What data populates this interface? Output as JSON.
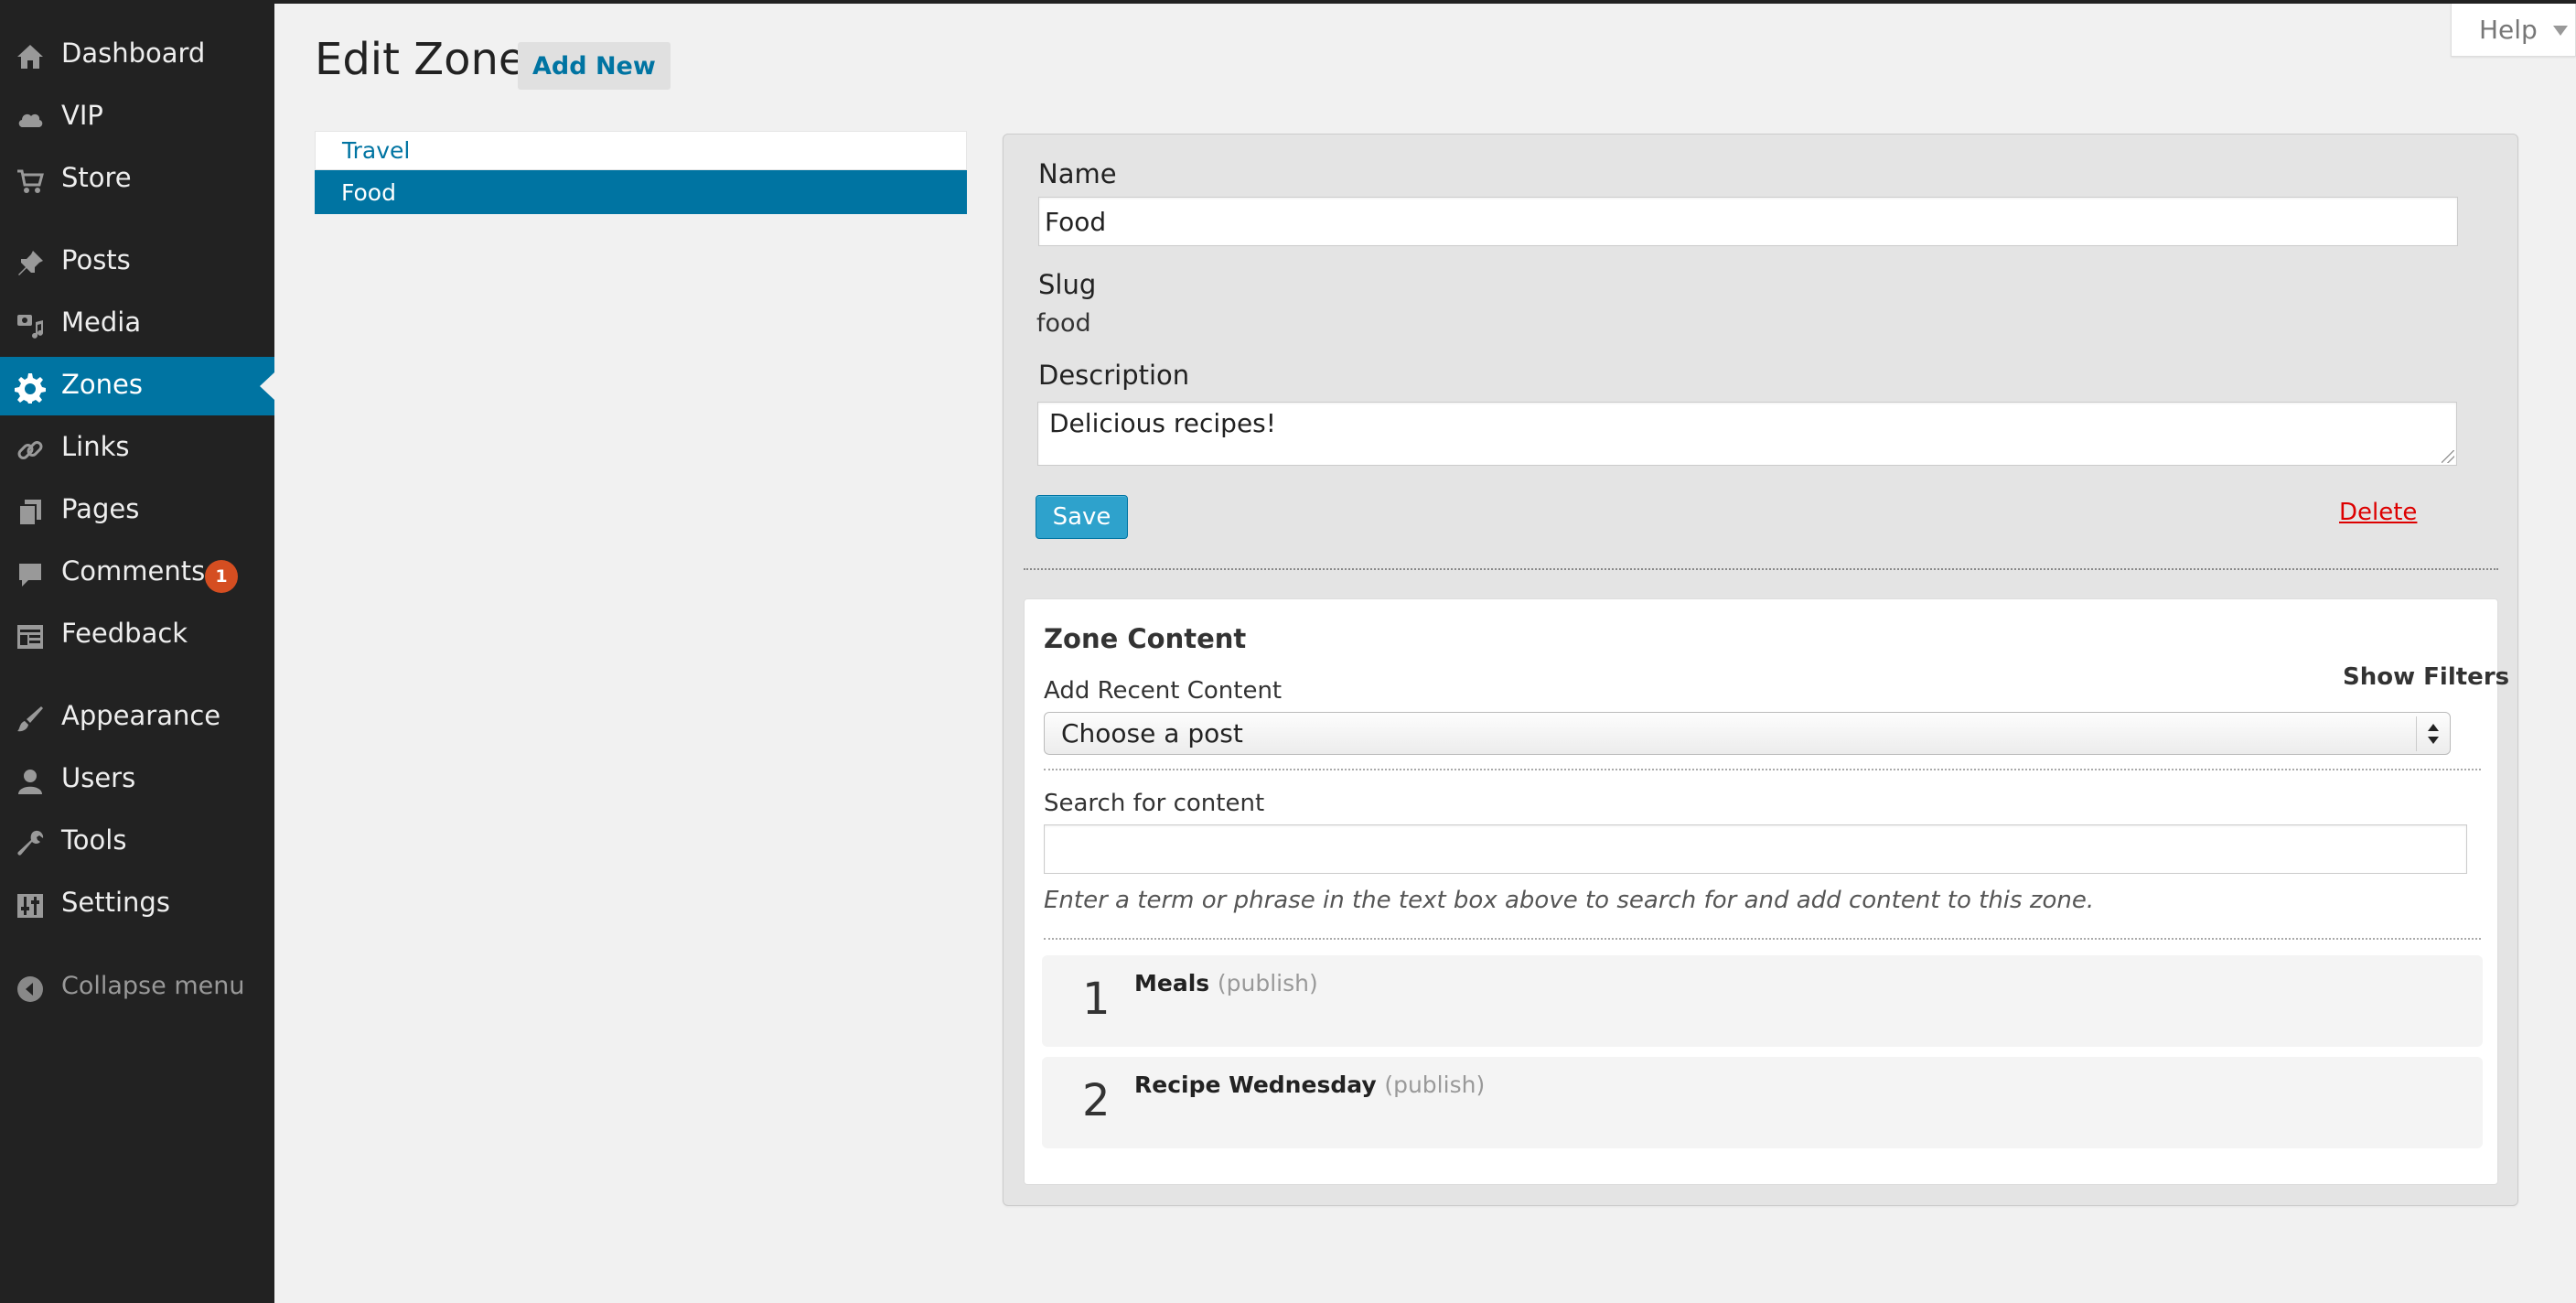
{
  "sidebar": {
    "items": [
      {
        "key": "dashboard",
        "label": "Dashboard",
        "icon": "home-icon"
      },
      {
        "key": "vip",
        "label": "VIP",
        "icon": "cloud-icon"
      },
      {
        "key": "store",
        "label": "Store",
        "icon": "cart-icon"
      },
      {
        "key": "posts",
        "label": "Posts",
        "icon": "pushpin-icon"
      },
      {
        "key": "media",
        "label": "Media",
        "icon": "camera-music-icon"
      },
      {
        "key": "zones",
        "label": "Zones",
        "icon": "gear-icon",
        "current": true
      },
      {
        "key": "links",
        "label": "Links",
        "icon": "link-icon"
      },
      {
        "key": "pages",
        "label": "Pages",
        "icon": "pages-icon"
      },
      {
        "key": "comments",
        "label": "Comments",
        "icon": "speech-bubble-icon",
        "badge": "1"
      },
      {
        "key": "feedback",
        "label": "Feedback",
        "icon": "feedback-icon"
      },
      {
        "key": "appearance",
        "label": "Appearance",
        "icon": "paintbrush-icon"
      },
      {
        "key": "users",
        "label": "Users",
        "icon": "user-icon"
      },
      {
        "key": "tools",
        "label": "Tools",
        "icon": "wrench-icon"
      },
      {
        "key": "settings",
        "label": "Settings",
        "icon": "sliders-icon"
      }
    ],
    "collapse_label": "Collapse menu"
  },
  "header": {
    "title": "Edit Zone",
    "add_new_label": "Add New",
    "help_label": "Help"
  },
  "zones": [
    {
      "label": "Travel",
      "active": false
    },
    {
      "label": "Food",
      "active": true
    }
  ],
  "form": {
    "name_label": "Name",
    "name_value": "Food",
    "slug_label": "Slug",
    "slug_value": "food",
    "description_label": "Description",
    "description_value": "Delicious recipes!",
    "save_label": "Save",
    "delete_label": "Delete"
  },
  "zone_content": {
    "heading": "Zone Content",
    "show_filters_label": "Show Filters",
    "add_recent_label": "Add Recent Content",
    "select_value": "Choose a post",
    "search_label": "Search for content",
    "search_value": "",
    "search_help": "Enter a term or phrase in the text box above to search for and add content to this zone.",
    "items": [
      {
        "number": "1",
        "title": "Meals",
        "status": "(publish)"
      },
      {
        "number": "2",
        "title": "Recipe Wednesday",
        "status": "(publish)"
      }
    ]
  },
  "colors": {
    "sidebar_bg": "#222222",
    "accent": "#0074a2",
    "button": "#2ea2cc",
    "delete": "#dd0000",
    "badge": "#d54e21"
  }
}
